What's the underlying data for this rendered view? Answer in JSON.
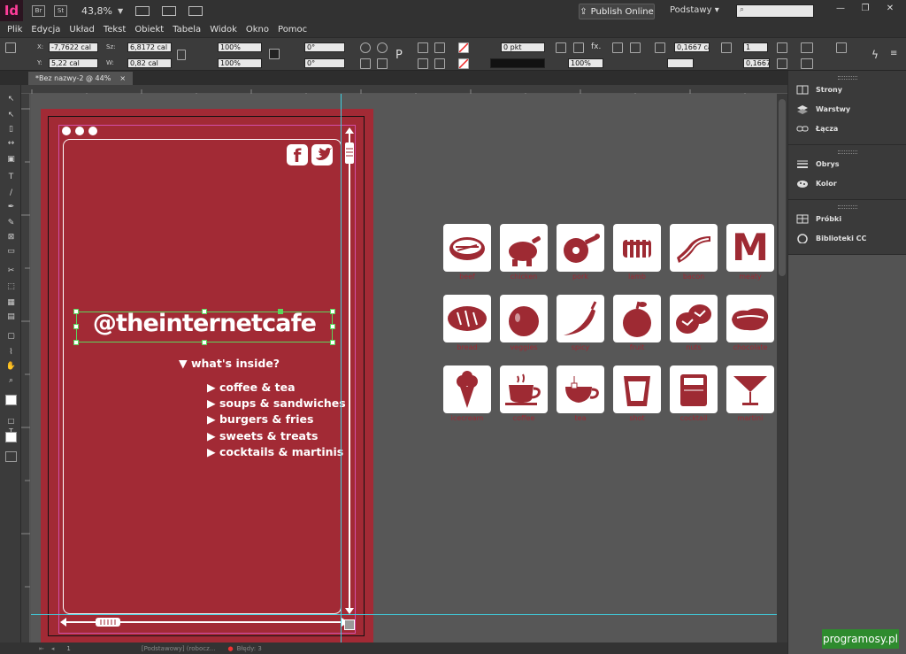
{
  "app": {
    "logo": "Id",
    "zoom": "43,8%",
    "publish_label": "Publish Online",
    "workspace": "Podstawy",
    "search_placeholder": "",
    "br_label": "Br",
    "st_label": "St"
  },
  "menu": [
    "Plik",
    "Edycja",
    "Układ",
    "Tekst",
    "Obiekt",
    "Tabela",
    "Widok",
    "Okno",
    "Pomoc"
  ],
  "control": {
    "x_label": "X:",
    "x_value": "-7,7622 cal",
    "y_label": "Y:",
    "y_value": "5,22 cal",
    "w_label": "Sz:",
    "w_value": "6,8172 cal",
    "h_label": "W:",
    "h_value": "0,82 cal",
    "scale_x": "100%",
    "scale_y": "100%",
    "angle": "0°",
    "shear": "0°",
    "stroke_weight": "0 pkt",
    "opacity": "100%",
    "spacing": "0,1667 cal",
    "spacing2": "0,1667 c",
    "columns": "1"
  },
  "tab": {
    "title": "*Bez nazwy-2 @ 44%",
    "close": "×"
  },
  "panels": [
    {
      "group": 1,
      "items": [
        {
          "label": "Strony",
          "icon": "pages-icon"
        },
        {
          "label": "Warstwy",
          "icon": "layers-icon"
        },
        {
          "label": "Łącza",
          "icon": "links-icon"
        }
      ]
    },
    {
      "group": 2,
      "items": [
        {
          "label": "Obrys",
          "icon": "stroke-icon"
        },
        {
          "label": "Kolor",
          "icon": "color-icon"
        }
      ]
    },
    {
      "group": 3,
      "items": [
        {
          "label": "Próbki",
          "icon": "swatches-icon"
        },
        {
          "label": "Biblioteki CC",
          "icon": "cc-libraries-icon"
        }
      ]
    }
  ],
  "flyer": {
    "handle": "@theinternetcafe",
    "inside": "what's inside?",
    "items": [
      "coffee & tea",
      "soups & sandwiches",
      "burgers & fries",
      "sweets & treats",
      "cocktails & martinis"
    ],
    "social": [
      "f",
      "twitter"
    ]
  },
  "icon_grid": [
    {
      "label": "beef",
      "icon": "steak-icon"
    },
    {
      "label": "chicken",
      "icon": "chicken-icon"
    },
    {
      "label": "pork",
      "icon": "ham-icon"
    },
    {
      "label": "lamb",
      "icon": "ribs-icon"
    },
    {
      "label": "bacon",
      "icon": "bacon-icon"
    },
    {
      "label": "meaty",
      "icon": "m-icon",
      "glyph": "M"
    },
    {
      "label": "bread",
      "icon": "bread-icon"
    },
    {
      "label": "veggies",
      "icon": "tomato-icon"
    },
    {
      "label": "spicy",
      "icon": "pepper-icon"
    },
    {
      "label": "fruit",
      "icon": "apple-icon"
    },
    {
      "label": "nuts",
      "icon": "nuts-icon"
    },
    {
      "label": "chocolate",
      "icon": "chocolate-icon"
    },
    {
      "label": "icecream",
      "icon": "icecream-icon"
    },
    {
      "label": "coffee",
      "icon": "coffee-icon"
    },
    {
      "label": "tea",
      "icon": "tea-icon"
    },
    {
      "label": "shot",
      "icon": "shot-icon"
    },
    {
      "label": "cocktail",
      "icon": "cocktail-icon"
    },
    {
      "label": "martini",
      "icon": "martini-icon"
    }
  ],
  "status": {
    "page": "1",
    "master": "[Podstawowy] (robocz...",
    "errors": "Błędy: 3"
  },
  "watermark": "programosy.pl",
  "colors": {
    "accent": "#a22a35",
    "icon_red": "#9e2a33",
    "guide_cyan": "#3fd0e0",
    "selection_green": "#5cd65c"
  }
}
